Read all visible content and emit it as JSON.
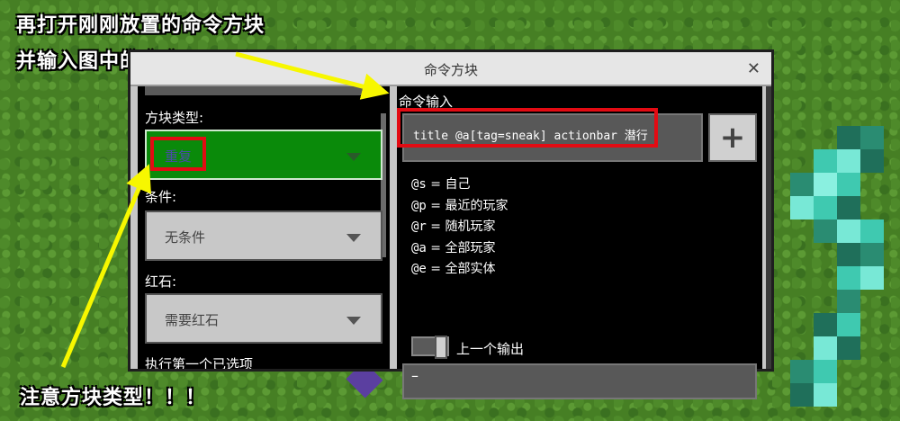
{
  "annotations": {
    "top_line1": "再打开刚刚放置的命令方块",
    "top_line2": "并输入图中的命令",
    "bottom": "注意方块类型！！！"
  },
  "dialog": {
    "title": "命令方块",
    "close_glyph": "✕"
  },
  "left": {
    "block_type_label": "方块类型:",
    "block_type_value": "重复",
    "condition_label": "条件:",
    "condition_value": "无条件",
    "redstone_label": "红石:",
    "redstone_value": "需要红石",
    "exec_label": "执行第一个已选项"
  },
  "right": {
    "command_input_label": "命令输入",
    "command_text": "title @a[tag=sneak] actionbar 潜行",
    "plus_glyph": "+",
    "help": [
      {
        "sel": "@s",
        "eq": " = ",
        "desc": "自己"
      },
      {
        "sel": "@p",
        "eq": " = ",
        "desc": "最近的玩家"
      },
      {
        "sel": "@r",
        "eq": " = ",
        "desc": "随机玩家"
      },
      {
        "sel": "@a",
        "eq": " = ",
        "desc": "全部玩家"
      },
      {
        "sel": "@e",
        "eq": " = ",
        "desc": "全部实体"
      }
    ],
    "previous_output_label": "上一个输出",
    "output_value": "–"
  },
  "colors": {
    "highlight": "#e30b13",
    "arrow": "#f7f700",
    "repeat_block": "#0a8a0a"
  }
}
